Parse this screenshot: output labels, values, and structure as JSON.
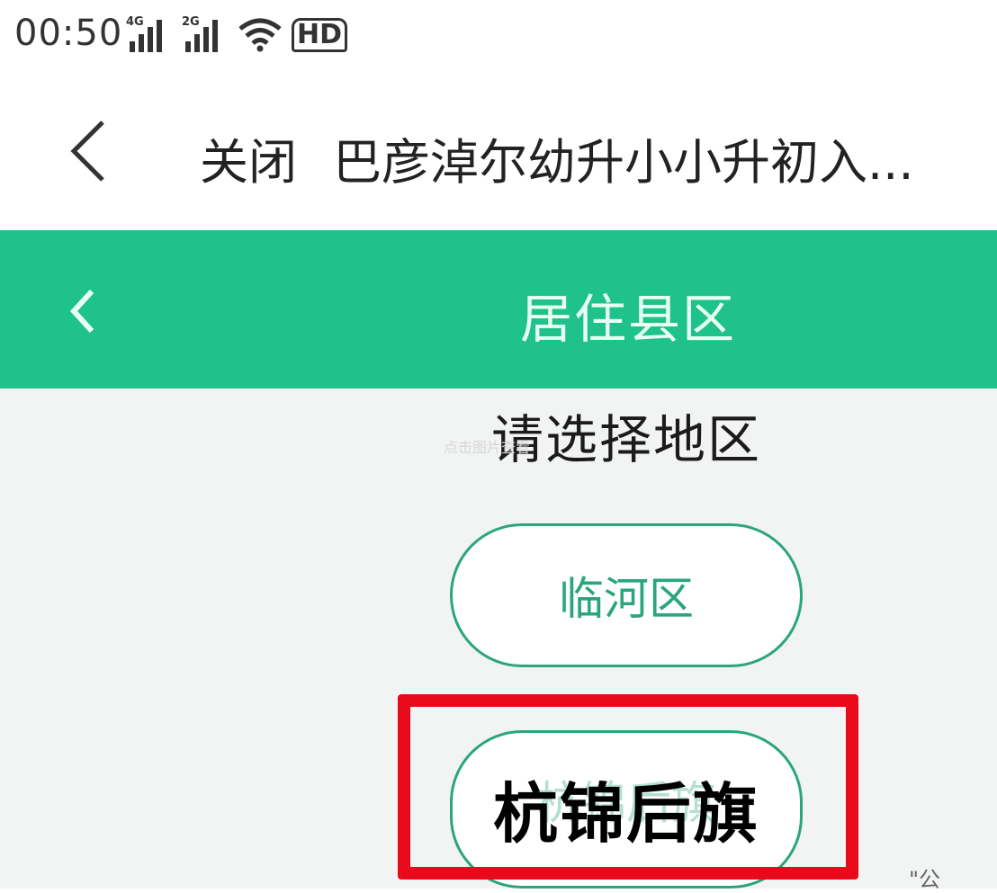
{
  "status_bar": {
    "time": "00:50",
    "signal_1_tag": "4G",
    "signal_2_tag": "2G",
    "wifi_icon": "wifi-icon",
    "hd_label": "HD"
  },
  "title_bar": {
    "close_label": "关闭",
    "title": "巴彦淖尔幼升小小升初入..."
  },
  "header": {
    "title": "居住县区",
    "accent_color": "#20c28c"
  },
  "content": {
    "prompt": "请选择地区",
    "watermark": "点击图片查看",
    "regions": [
      {
        "label": "临河区"
      },
      {
        "label": "杭锦后旗",
        "highlighted": true
      }
    ],
    "highlight_color": "#e8091a",
    "corner_text": "\"公"
  }
}
